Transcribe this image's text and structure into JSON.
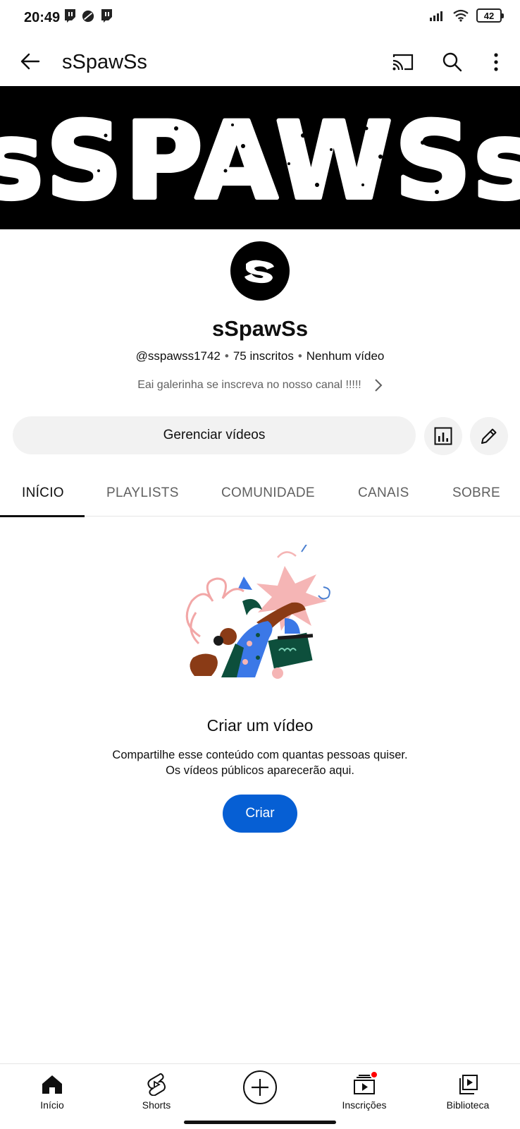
{
  "status_bar": {
    "time": "20:49",
    "battery": "42",
    "icons_left": [
      "twitch-icon",
      "app-icon",
      "twitch-icon"
    ],
    "icons_right": [
      "signal-icon",
      "wifi-icon",
      "battery-icon"
    ]
  },
  "app_bar": {
    "title": "sSpawSs",
    "icons": [
      "back-arrow-icon",
      "cast-icon",
      "search-icon",
      "more-vert-icon"
    ]
  },
  "banner": {
    "text": "sSPAWSs",
    "colors": {
      "background": "#000000",
      "text": "#ffffff"
    }
  },
  "channel": {
    "name": "sSpawSs",
    "handle": "@sspawss1742",
    "subscribers": "75 inscritos",
    "videos": "Nenhum vídeo",
    "description": "Eai galerinha se inscreva no nosso canal !!!!!"
  },
  "actions": {
    "manage_label": "Gerenciar vídeos",
    "icons": [
      "analytics-icon",
      "edit-icon"
    ]
  },
  "tabs": [
    {
      "label": "INÍCIO",
      "active": true
    },
    {
      "label": "PLAYLISTS",
      "active": false
    },
    {
      "label": "COMUNIDADE",
      "active": false
    },
    {
      "label": "CANAIS",
      "active": false
    },
    {
      "label": "SOBRE",
      "active": false
    }
  ],
  "empty_state": {
    "title": "Criar um vídeo",
    "line1": "Compartilhe esse conteúdo com quantas pessoas quiser.",
    "line2": "Os vídeos públicos aparecerão aqui.",
    "button": "Criar"
  },
  "bottom_nav": [
    {
      "label": "Início",
      "icon": "home-icon"
    },
    {
      "label": "Shorts",
      "icon": "shorts-icon"
    },
    {
      "label": "",
      "icon": "create-plus-icon"
    },
    {
      "label": "Inscrições",
      "icon": "subscriptions-icon"
    },
    {
      "label": "Biblioteca",
      "icon": "library-icon"
    }
  ],
  "colors": {
    "accent": "#065fd4",
    "chip_background": "#f2f2f2",
    "secondary_text": "#606060",
    "notification": "#ff0000"
  }
}
